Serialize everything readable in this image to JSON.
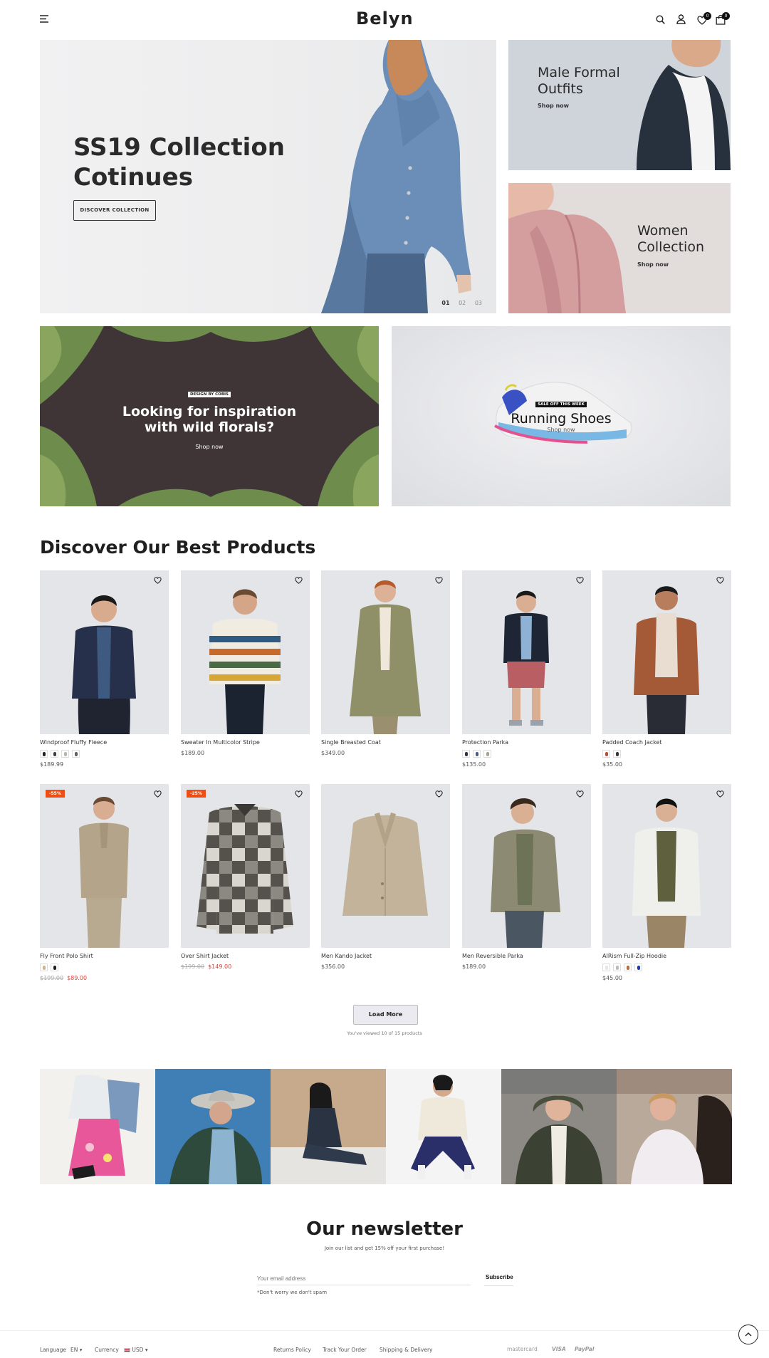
{
  "header": {
    "logo": "Belyn",
    "wishlist_count": "0",
    "cart_count": "0"
  },
  "hero": {
    "title_line1": "SS19 Collection",
    "title_line2": "Cotinues",
    "button": "DISCOVER COLLECTION",
    "slides": [
      "01",
      "02",
      "03"
    ]
  },
  "side_banners": [
    {
      "title_line1": "Male Formal",
      "title_line2": "Outfits",
      "link": "Shop now"
    },
    {
      "title_line1": "Women",
      "title_line2": "Collection",
      "link": "Shop now"
    }
  ],
  "promo_banners": [
    {
      "tag": "DESIGN BY COBIS",
      "title_line1": "Looking for inspiration",
      "title_line2": "with wild florals?",
      "link": "Shop now"
    },
    {
      "tag": "SALE OFF THIS WEEK",
      "title": "Running Shoes",
      "link": "Shop now"
    }
  ],
  "products_section": {
    "title": "Discover Our Best Products",
    "items": [
      {
        "name": "Windproof Fluffy Fleece",
        "price": "$189.99",
        "sale_badge": "",
        "old_price": "",
        "swatches": [
          "#1e2228",
          "#3a3d44",
          "#b9b5ac",
          "#5d6067"
        ]
      },
      {
        "name": "Sweater In Multicolor Stripe",
        "price": "$189.00",
        "sale_badge": "",
        "old_price": "",
        "swatches": []
      },
      {
        "name": "Single Breasted Coat",
        "price": "$349.00",
        "sale_badge": "",
        "old_price": "",
        "swatches": []
      },
      {
        "name": "Protection Parka",
        "price": "$135.00",
        "sale_badge": "",
        "old_price": "",
        "swatches": [
          "#2d3340",
          "#4e5b80",
          "#a8a195"
        ]
      },
      {
        "name": "Padded Coach Jacket",
        "price": "$35.00",
        "sale_badge": "",
        "old_price": "",
        "swatches": [
          "#b94d3a",
          "#35373b"
        ]
      },
      {
        "name": "Fly Front Polo Shirt",
        "price": "$89.00",
        "sale_badge": "-55%",
        "old_price": "$199.00",
        "swatches": [
          "#c9b789",
          "#202020"
        ]
      },
      {
        "name": "Over Shirt Jacket",
        "price": "$149.00",
        "sale_badge": "-25%",
        "old_price": "$199.00",
        "swatches": []
      },
      {
        "name": "Men Kando Jacket",
        "price": "$356.00",
        "sale_badge": "",
        "old_price": "",
        "swatches": []
      },
      {
        "name": "Men Reversible Parka",
        "price": "$189.00",
        "sale_badge": "",
        "old_price": "",
        "swatches": []
      },
      {
        "name": "AIRism Full-Zip Hoodie",
        "price": "$45.00",
        "sale_badge": "",
        "old_price": "",
        "swatches": [
          "#e6e6e2",
          "#bdbdb8",
          "#b76a3c",
          "#1b3ab8"
        ]
      }
    ],
    "load_more": "Load More",
    "viewed_text": "You've viewed 10 of 15 products"
  },
  "newsletter": {
    "title": "Our newsletter",
    "subtitle": "Join our list and get 15% off your first purchase!",
    "placeholder": "Your email address",
    "button": "Subscribe",
    "note": "*Don't worry we don't spam"
  },
  "footer": {
    "language_label": "Language",
    "language_value": "EN",
    "currency_label": "Currency",
    "currency_value": "USD",
    "links": [
      "Returns Policy",
      "Track Your Order",
      "Shipping & Delivery"
    ],
    "payments": [
      "mastercard",
      "VISA",
      "PayPal"
    ]
  },
  "colors": {
    "accent_sale": "#ec4e14",
    "price_sale": "#e53b2e",
    "banner_dark": "#3f3536"
  }
}
